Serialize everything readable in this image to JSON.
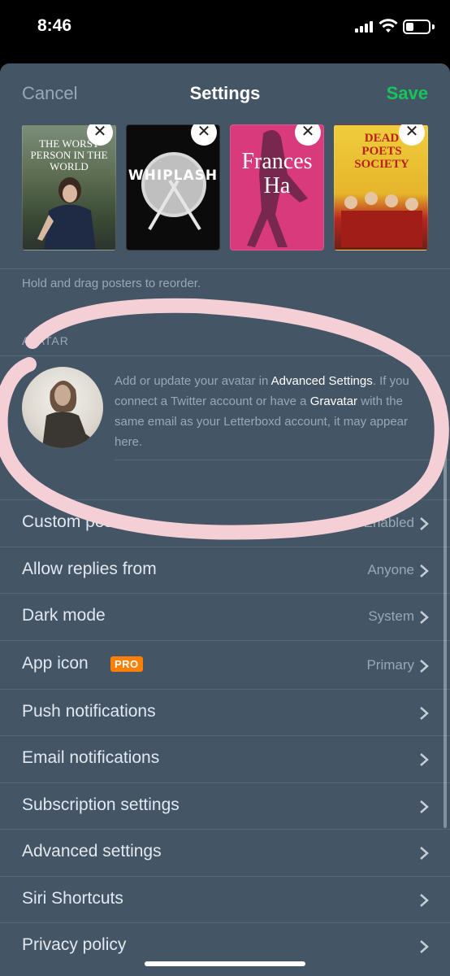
{
  "status_bar": {
    "time": "8:46"
  },
  "nav": {
    "cancel": "Cancel",
    "title": "Settings",
    "save": "Save"
  },
  "posters": [
    {
      "title": "THE WORST PERSON IN THE WORLD",
      "remove": "✕"
    },
    {
      "title": "WHIPLASH",
      "remove": "✕"
    },
    {
      "title": "Frances Ha",
      "remove": "✕"
    },
    {
      "title": "DEAD POETS SOCIETY",
      "remove": "✕"
    }
  ],
  "posters_hint": "Hold and drag posters to reorder.",
  "avatar": {
    "header": "AVATAR",
    "text_1": "Add or update your avatar in ",
    "link_1": "Advanced Settings",
    "text_2": ". If you connect a Twitter account or have a ",
    "link_2": "Gravatar",
    "text_3": " with the same email as your Letterboxd account, it may appear here."
  },
  "settings": [
    {
      "label": "Custom posters",
      "value": "Enabled"
    },
    {
      "label": "Allow replies from",
      "value": "Anyone"
    },
    {
      "label": "Dark mode",
      "value": "System"
    },
    {
      "label": "App icon",
      "value": "Primary",
      "badge": "PRO"
    },
    {
      "label": "Push notifications",
      "value": ""
    },
    {
      "label": "Email notifications",
      "value": ""
    },
    {
      "label": "Subscription settings",
      "value": ""
    },
    {
      "label": "Advanced settings",
      "value": ""
    },
    {
      "label": "Siri Shortcuts",
      "value": ""
    },
    {
      "label": "Privacy policy",
      "value": ""
    }
  ],
  "colors": {
    "background": "#445566",
    "accent_save": "#16c65b",
    "pro_badge": "#ff8000",
    "annotation": "#f5cfd6"
  }
}
